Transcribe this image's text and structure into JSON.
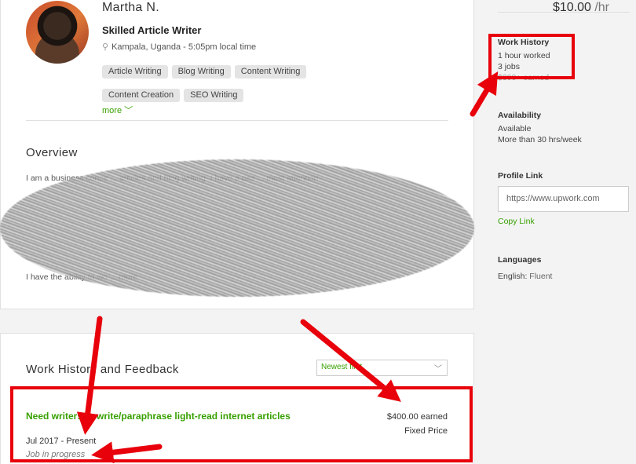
{
  "profile": {
    "name": "Martha N.",
    "rate": "$10.00",
    "rate_unit": "/hr",
    "title": "Skilled Article Writer",
    "location": "Kampala, Uganda - 5:05pm local time",
    "skills": [
      "Article Writing",
      "Blog Writing",
      "Content Writing",
      "Content Creation",
      "SEO Writing"
    ],
    "more_label": "more"
  },
  "overview": {
    "heading": "Overview",
    "text": "I am a business conce ... articles and blog writing. I have a pas ... most attention",
    "text2": "I have the ability to wo ... more"
  },
  "sidebar": {
    "work_history_heading": "Work History",
    "hours_worked": "1 hour worked",
    "jobs": "3 jobs",
    "earned": "$300+ earned",
    "availability_heading": "Availability",
    "availability_status": "Available",
    "availability_hours": "More than 30 hrs/week",
    "profile_link_heading": "Profile Link",
    "profile_link_value": "https://www.upwork.com",
    "copy_link_label": "Copy Link",
    "languages_heading": "Languages",
    "language_label": "English:",
    "language_level": "Fluent"
  },
  "work_history": {
    "heading": "Work History and Feedback",
    "sort_selected": "Newest first",
    "job": {
      "title": "Need writers to write/paraphrase light-read internet articles",
      "date": "Jul 2017 - Present",
      "status": "Job in progress",
      "earned": "$400.00 earned",
      "type": "Fixed Price"
    }
  },
  "colors": {
    "accent_green": "#37a000",
    "annotation_red": "#e8000b"
  }
}
